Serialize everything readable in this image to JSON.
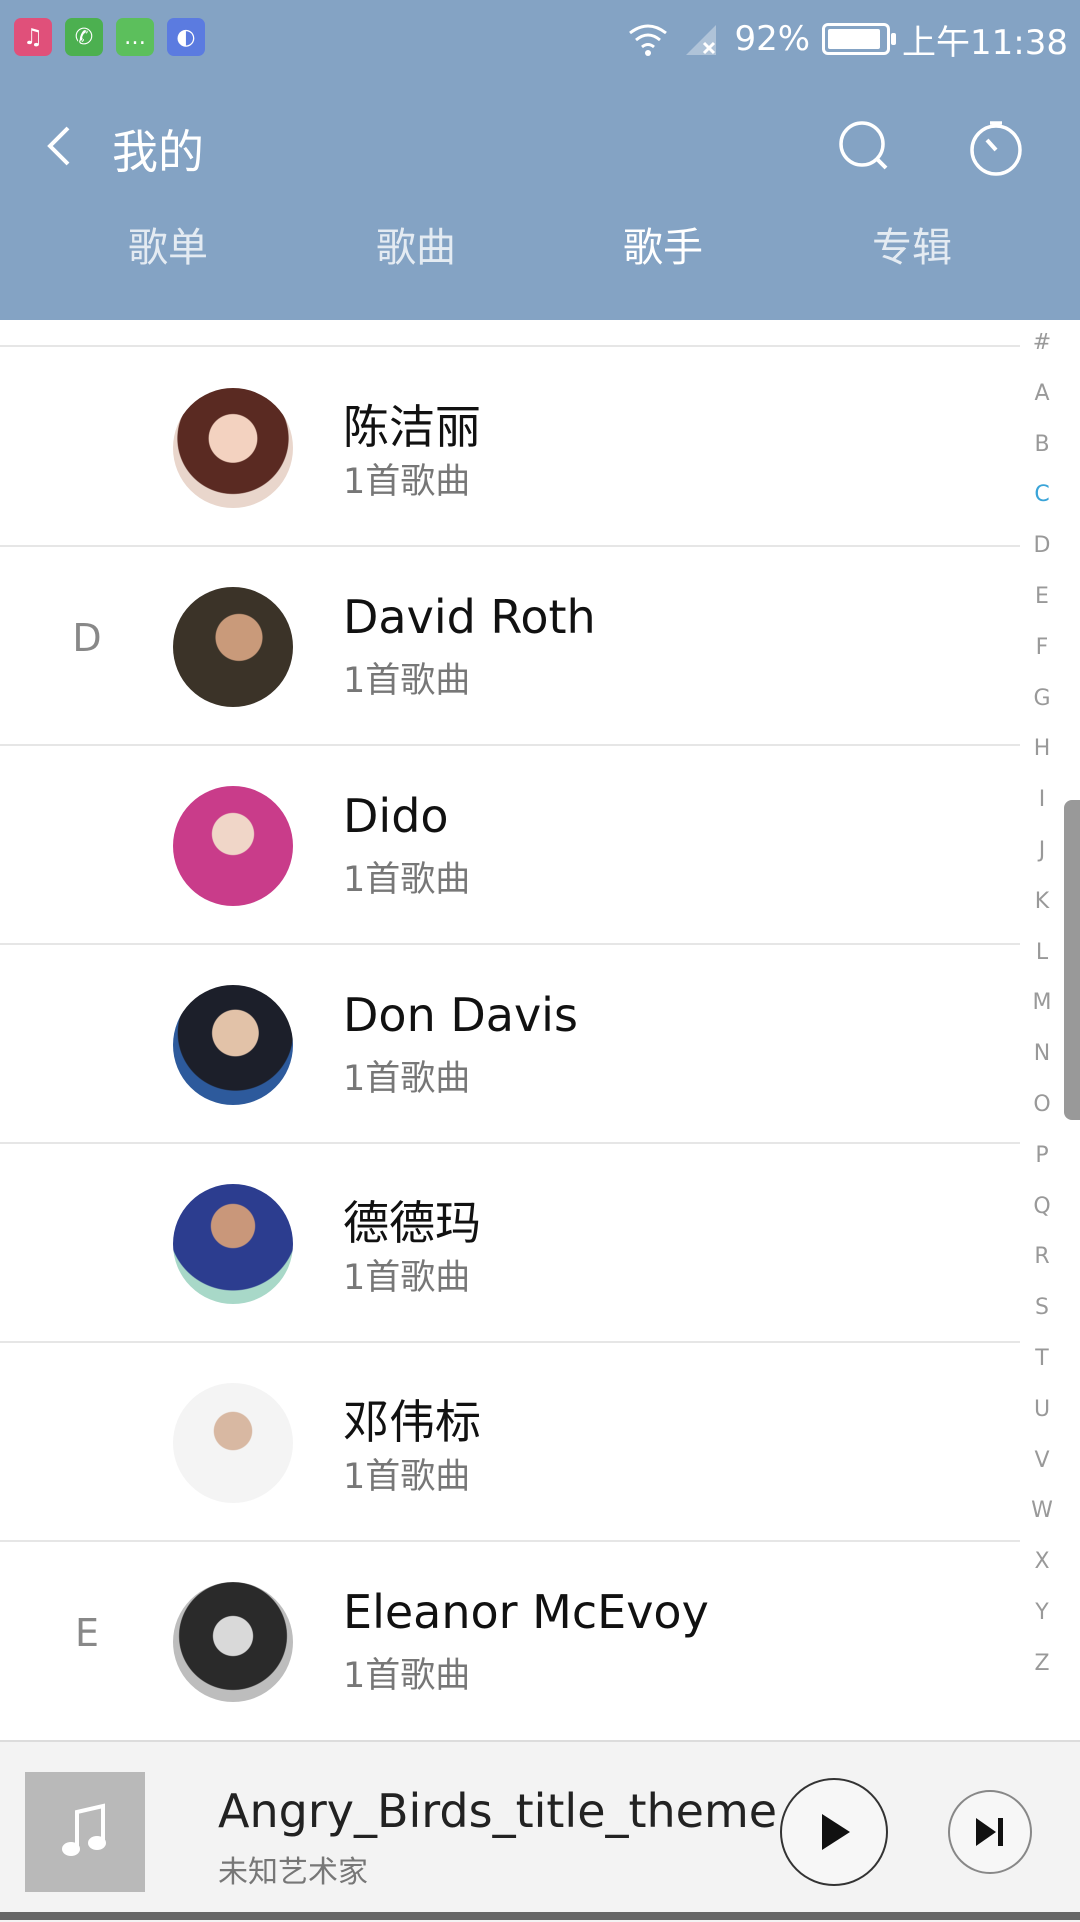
{
  "status_bar": {
    "notification_icons": [
      "music-app-icon",
      "phone-icon",
      "message-icon",
      "browser-icon"
    ],
    "battery_percent": "92%",
    "battery_level": 0.92,
    "time": "上午11:38"
  },
  "header": {
    "title": "我的",
    "tabs": [
      {
        "label": "歌单"
      },
      {
        "label": "歌曲"
      },
      {
        "label": "歌手"
      },
      {
        "label": "专辑"
      }
    ],
    "active_tab": "歌手"
  },
  "artists": [
    {
      "index_letter": "",
      "name": "陈洁丽",
      "song_count": "1首歌曲"
    },
    {
      "index_letter": "D",
      "name": "David Roth",
      "song_count": "1首歌曲"
    },
    {
      "index_letter": "",
      "name": "Dido",
      "song_count": "1首歌曲"
    },
    {
      "index_letter": "",
      "name": "Don Davis",
      "song_count": "1首歌曲"
    },
    {
      "index_letter": "",
      "name": "德德玛",
      "song_count": "1首歌曲"
    },
    {
      "index_letter": "",
      "name": "邓伟标",
      "song_count": "1首歌曲"
    },
    {
      "index_letter": "E",
      "name": "Eleanor McEvoy",
      "song_count": "1首歌曲"
    }
  ],
  "alphabet_index": [
    "#",
    "A",
    "B",
    "C",
    "D",
    "E",
    "F",
    "G",
    "H",
    "I",
    "J",
    "K",
    "L",
    "M",
    "N",
    "O",
    "P",
    "Q",
    "R",
    "S",
    "T",
    "U",
    "V",
    "W",
    "X",
    "Y",
    "Z"
  ],
  "alphabet_active": "C",
  "player": {
    "title": "Angry_Birds_title_theme",
    "artist": "未知艺术家"
  },
  "colors": {
    "header_bg": "#84a3c4",
    "index_active": "#3aa4d8"
  }
}
